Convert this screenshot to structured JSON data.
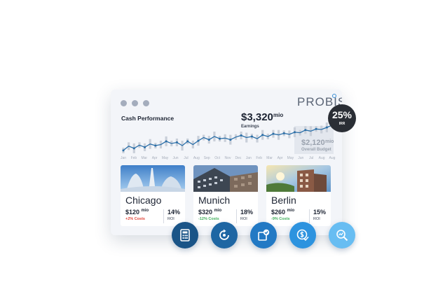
{
  "brand": "PROBIS",
  "colors": {
    "line": "#2b6fa8",
    "positive": "#3fae5a",
    "negative": "#e0453a",
    "badge": "#2a2e35"
  },
  "cash": {
    "title": "Cash Performance",
    "earnings_value": "$3,320",
    "earnings_unit": "mio",
    "earnings_label": "Earnings",
    "budget_value": "$2,120",
    "budget_unit": "mio",
    "budget_label": "Overall Budget"
  },
  "chart_data": {
    "type": "line",
    "x_labels": [
      "Jan",
      "Feb",
      "Mar",
      "Apr",
      "May",
      "Jun",
      "Jul",
      "Aug",
      "Sep",
      "Oct",
      "Nov",
      "Dec",
      "Jan",
      "Feb",
      "Mar",
      "Apr",
      "May",
      "Jun",
      "Jul",
      "Aug",
      "Aug"
    ],
    "values": [
      4,
      12,
      8,
      14,
      10,
      16,
      13,
      15,
      21,
      17,
      19,
      13,
      21,
      15,
      22,
      28,
      24,
      30,
      26,
      27,
      24,
      29,
      32,
      28,
      30,
      26,
      33,
      30,
      35,
      33,
      36,
      34,
      38,
      37,
      42,
      40,
      44,
      43,
      47,
      51
    ],
    "ylim": [
      0,
      60
    ]
  },
  "irr": {
    "value": "25%",
    "label": "IRR"
  },
  "cities": [
    {
      "name": "Chicago",
      "price": "$120",
      "unit": "mio",
      "cost": "+2% Costs",
      "cost_type": "neg",
      "roi": "14%",
      "roi_label": "ROI"
    },
    {
      "name": "Munich",
      "price": "$320",
      "unit": "mio",
      "cost": "-12% Costs",
      "cost_type": "pos",
      "roi": "18%",
      "roi_label": "ROI"
    },
    {
      "name": "Berlin",
      "price": "$260",
      "unit": "mio",
      "cost": "-9% Costs",
      "cost_type": "pos",
      "roi": "15%",
      "roi_label": "ROI"
    }
  ],
  "actions": [
    {
      "icon": "calculator-icon",
      "color": "#1a5487"
    },
    {
      "icon": "refresh-cycle-icon",
      "color": "#1e66a3"
    },
    {
      "icon": "approve-document-icon",
      "color": "#2279c4"
    },
    {
      "icon": "money-check-icon",
      "color": "#2d93df"
    },
    {
      "icon": "zoom-analysis-icon",
      "color": "#67bdf2"
    }
  ]
}
